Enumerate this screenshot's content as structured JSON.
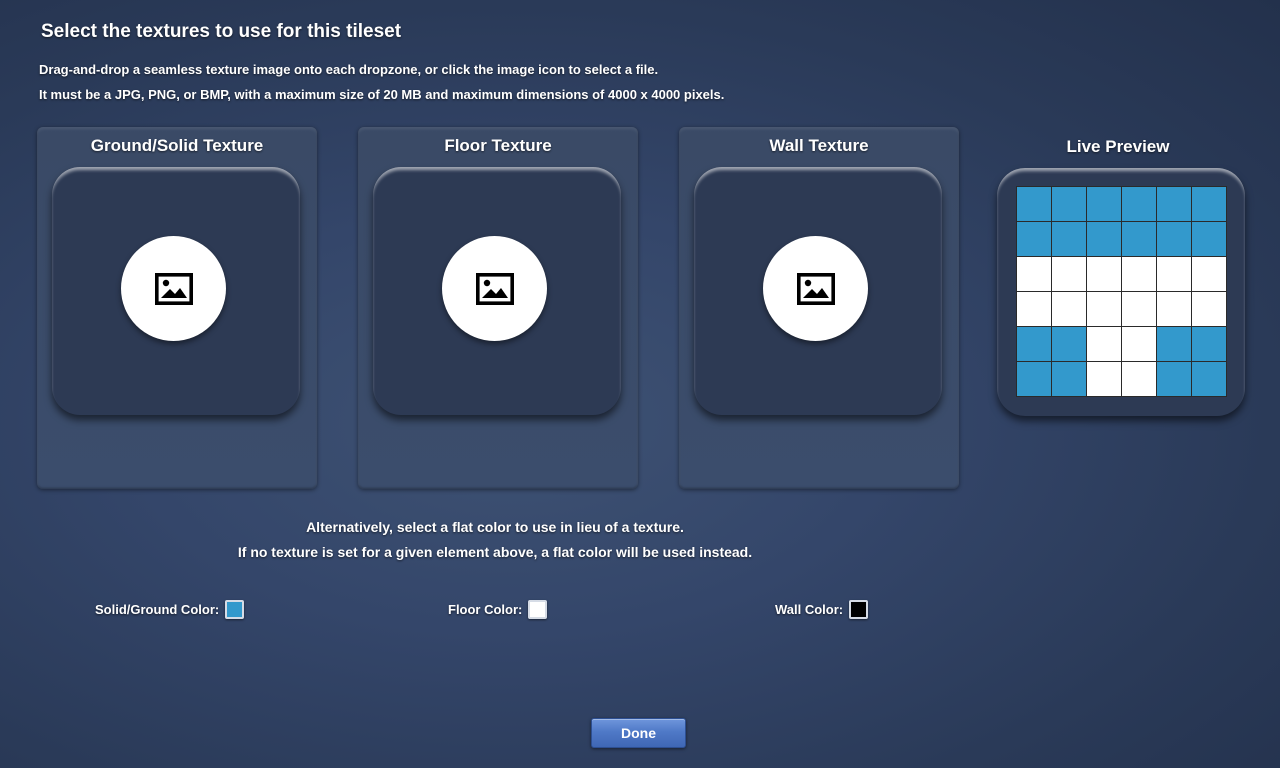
{
  "header": {
    "title": "Select the textures to use for this tileset",
    "instruction_1": "Drag-and-drop a seamless texture image onto each dropzone, or click the image icon to select a file.",
    "instruction_2": "It must be a JPG, PNG, or BMP, with a maximum size of 20 MB and maximum dimensions of 4000 x 4000 pixels."
  },
  "panels": [
    {
      "title": "Ground/Solid Texture",
      "icon": "image-icon"
    },
    {
      "title": "Floor Texture",
      "icon": "image-icon"
    },
    {
      "title": "Wall Texture",
      "icon": "image-icon"
    }
  ],
  "preview": {
    "title": "Live Preview",
    "colors": {
      "S": "#3399cc",
      "F": "#ffffff"
    },
    "grid": [
      [
        "S",
        "S",
        "S",
        "S",
        "S",
        "S"
      ],
      [
        "S",
        "S",
        "S",
        "S",
        "S",
        "S"
      ],
      [
        "F",
        "F",
        "F",
        "F",
        "F",
        "F"
      ],
      [
        "F",
        "F",
        "F",
        "F",
        "F",
        "F"
      ],
      [
        "S",
        "S",
        "F",
        "F",
        "S",
        "S"
      ],
      [
        "S",
        "S",
        "F",
        "F",
        "S",
        "S"
      ]
    ]
  },
  "alternative": {
    "line_1": "Alternatively, select a flat color to use in lieu of a texture.",
    "line_2": "If no texture is set for a given element above, a flat color will be used instead."
  },
  "colors": {
    "solid_label": "Solid/Ground Color:",
    "solid_value": "#3399cc",
    "floor_label": "Floor Color:",
    "floor_value": "#ffffff",
    "wall_label": "Wall Color:",
    "wall_value": "#000000"
  },
  "footer": {
    "done_label": "Done"
  }
}
